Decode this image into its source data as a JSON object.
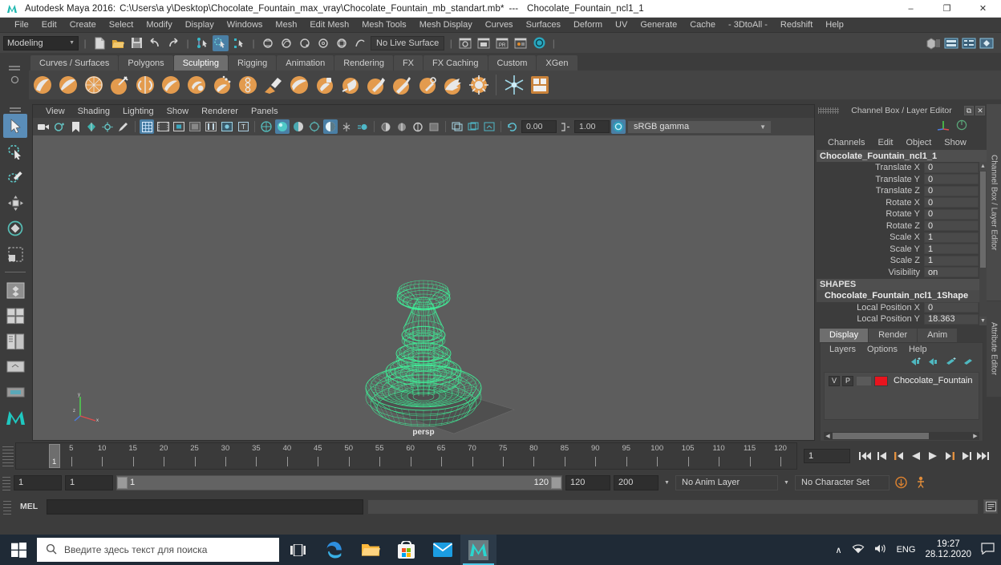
{
  "window": {
    "app_title": "Autodesk Maya 2016:",
    "file_path": "C:\\Users\\a y\\Desktop\\Chocolate_Fountain_max_vray\\Chocolate_Fountain_mb_standart.mb*",
    "separator": "---",
    "object_name": "Chocolate_Fountain_ncl1_1",
    "minimize": "–",
    "maximize": "❐",
    "close": "✕"
  },
  "menubar": {
    "items": [
      "File",
      "Edit",
      "Create",
      "Select",
      "Modify",
      "Display",
      "Windows",
      "Mesh",
      "Edit Mesh",
      "Mesh Tools",
      "Mesh Display",
      "Curves",
      "Surfaces",
      "Deform",
      "UV",
      "Generate",
      "Cache",
      "- 3DtoAll -",
      "Redshift",
      "Help"
    ]
  },
  "statusline": {
    "menuset_value": "Modeling",
    "menuset_arrow": "▼",
    "live_surface": "No Live Surface",
    "icons": [
      "new-scene-icon",
      "open-scene-icon",
      "save-scene-icon",
      "undo-icon",
      "redo-icon",
      "select-by-hierarchy-icon",
      "select-by-object-icon",
      "select-by-component-icon",
      "snap-to-grid-icon",
      "snap-to-curve-icon",
      "snap-to-point-icon",
      "snap-to-projected-center-icon",
      "snap-to-view-plane-icon",
      "make-live-icon",
      "render-current-frame-icon",
      "ipr-render-icon",
      "render-settings-icon",
      "hypershade-icon",
      "render-view-icon"
    ],
    "right_icons": [
      "show-hide-modeling-toolkit-icon",
      "show-hide-attribute-editor-icon",
      "show-hide-tool-settings-icon",
      "show-hide-channel-box-icon"
    ]
  },
  "shelf": {
    "tabs": [
      "Curves / Surfaces",
      "Polygons",
      "Sculpting",
      "Rigging",
      "Animation",
      "Rendering",
      "FX",
      "FX Caching",
      "Custom",
      "XGen"
    ],
    "active_tab": "Sculpting",
    "tools": [
      "sculpt-tool-icon",
      "smooth-tool-icon",
      "relax-tool-icon",
      "grab-tool-icon",
      "pinch-tool-icon",
      "flatten-tool-icon",
      "foamy-tool-icon",
      "spray-tool-icon",
      "repeat-tool-icon",
      "imprint-tool-icon",
      "wax-tool-icon",
      "scrape-tool-icon",
      "fill-tool-icon",
      "knife-tool-icon",
      "smear-tool-icon",
      "bulge-tool-icon",
      "amplify-tool-icon",
      "freeze-tool-icon",
      "convert-tool-icon",
      "mirror-tool-icon",
      "sculpt-options-icon"
    ]
  },
  "toolbox": {
    "tools": [
      "select-tool-icon",
      "lasso-select-tool-icon",
      "paint-select-tool-icon",
      "move-tool-icon",
      "rotate-tool-icon",
      "scale-tool-icon",
      "last-tool-icon",
      "single-perspective-view-icon",
      "four-view-layout-icon",
      "persp-outliner-layout-icon",
      "persp-graph-layout-icon",
      "hypershade-persp-layout-icon"
    ],
    "selected": "select-tool-icon"
  },
  "viewport": {
    "panel_menus": [
      "View",
      "Shading",
      "Lighting",
      "Show",
      "Renderer",
      "Panels"
    ],
    "camera_label": "persp",
    "gamma_value": "sRGB gamma",
    "exposure_value": "0.00",
    "gamma_num": "1.00",
    "gamma_arrow": "▼",
    "toolbar_icons": [
      "camera-icon",
      "bookmark-view-icon",
      "image-plane-icon",
      "grid-toggle-icon",
      "film-gate-icon",
      "resolution-gate-icon",
      "gate-mask-icon",
      "xray-icon",
      "xray-joints-icon",
      "texture-icon",
      "wireframe-shading-icon",
      "smooth-shade-all-icon",
      "smooth-shade-textured-icon",
      "use-all-lights-icon",
      "shadows-icon",
      "ambient-occlusion-icon",
      "motion-blur-icon",
      "multisample-icon",
      "isolate-select-icon",
      "grid-display-icon",
      "film-origin-icon",
      "exposure-icon",
      "gamma-icon",
      "color-management-icon"
    ],
    "wireframe_color": "#3ff49a"
  },
  "channelbox": {
    "title": "Channel Box / Layer Editor",
    "undock_btn": "⧉",
    "close_btn": "✕",
    "menus": [
      "Channels",
      "Edit",
      "Object",
      "Show"
    ],
    "node_name": "Chocolate_Fountain_ncl1_1",
    "attributes": [
      {
        "label": "Translate X",
        "value": "0"
      },
      {
        "label": "Translate Y",
        "value": "0"
      },
      {
        "label": "Translate Z",
        "value": "0"
      },
      {
        "label": "Rotate X",
        "value": "0"
      },
      {
        "label": "Rotate Y",
        "value": "0"
      },
      {
        "label": "Rotate Z",
        "value": "0"
      },
      {
        "label": "Scale X",
        "value": "1"
      },
      {
        "label": "Scale Y",
        "value": "1"
      },
      {
        "label": "Scale Z",
        "value": "1"
      },
      {
        "label": "Visibility",
        "value": "on"
      }
    ],
    "shapes_header": "SHAPES",
    "shape_name": "Chocolate_Fountain_ncl1_1Shape",
    "shape_attributes": [
      {
        "label": "Local Position X",
        "value": "0"
      },
      {
        "label": "Local Position Y",
        "value": "18.363"
      }
    ],
    "scroll_up": "▲",
    "scroll_down": "▼"
  },
  "layer_editor": {
    "tabs": [
      "Display",
      "Render",
      "Anim"
    ],
    "active_tab": "Display",
    "menus": [
      "Layers",
      "Options",
      "Help"
    ],
    "buttons": [
      "new-layer-icon",
      "new-layer-from-selected-icon",
      "add-selected-to-layer-icon",
      "remove-selected-from-layer-icon"
    ],
    "layers": [
      {
        "visibility": "V",
        "playback": "P",
        "color": "#e8141e",
        "name": "Chocolate_Fountain"
      }
    ],
    "scroll_left": "◀",
    "scroll_right": "▶"
  },
  "sidetabs": [
    "Channel Box / Layer Editor",
    "Attribute Editor"
  ],
  "timeline": {
    "ticks": [
      5,
      10,
      15,
      20,
      25,
      30,
      35,
      40,
      45,
      50,
      55,
      60,
      65,
      70,
      75,
      80,
      85,
      90,
      95,
      100,
      105,
      110,
      115,
      120
    ],
    "current_frame": "1",
    "current_frame_field": "1",
    "playback_buttons": [
      "go-to-start-icon",
      "step-back-keyframe-icon",
      "step-back-frame-icon",
      "play-backwards-icon",
      "play-forwards-icon",
      "step-forward-frame-icon",
      "step-forward-keyframe-icon",
      "go-to-end-icon"
    ]
  },
  "range_slider": {
    "anim_start": "1",
    "range_start": "1",
    "bar_start_label": "1",
    "bar_end_label": "120",
    "range_end": "120",
    "anim_end": "200",
    "anim_layer": "No Anim Layer",
    "character_set": "No Character Set",
    "dropdown_arrow": "▼",
    "right_icons": [
      "auto-keyframe-icon",
      "animation-preferences-icon"
    ]
  },
  "command_line": {
    "language_label": "MEL",
    "input_value": "",
    "output_value": "",
    "script_editor_icon": "script-editor-icon"
  },
  "taskbar": {
    "start_icon": "windows-start-icon",
    "search_placeholder": "Введите здесь текст для поиска",
    "search_icon": "search-icon",
    "task_view_icon": "task-view-icon",
    "apps": [
      "edge-browser-icon",
      "file-explorer-icon",
      "microsoft-store-icon",
      "mail-icon",
      "maya-icon"
    ],
    "tray": {
      "chevron": "∧",
      "network_icon": "wifi-icon",
      "volume_icon": "volume-icon",
      "language": "ENG",
      "time": "19:27",
      "date": "28.12.2020",
      "notifications_icon": "notification-center-icon"
    }
  }
}
